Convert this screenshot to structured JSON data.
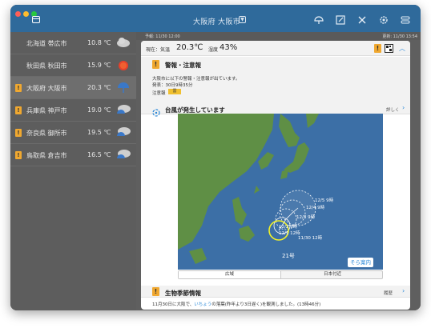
{
  "window": {
    "title": "大阪府 大阪市",
    "dropdown_glyph": "▼",
    "toolbar_icons": [
      "weather-icon",
      "edit-icon",
      "tools-icon",
      "settings-icon",
      "toggle-icon"
    ]
  },
  "sidebar": {
    "items": [
      {
        "warning": false,
        "city": "北海道 帯広市",
        "temp": "10.8 ℃",
        "icon": "cloudy-icon"
      },
      {
        "warning": false,
        "city": "秋田県 秋田市",
        "temp": "15.9 ℃",
        "icon": "sunny-icon"
      },
      {
        "warning": true,
        "city": "大阪府 大阪市",
        "temp": "20.3 ℃",
        "icon": "umbrella-icon"
      },
      {
        "warning": true,
        "city": "兵庫県 神戸市",
        "temp": "19.0 ℃",
        "icon": "rain-cloud-icon"
      },
      {
        "warning": true,
        "city": "奈良県 御所市",
        "temp": "19.5 ℃",
        "icon": "rain-cloud-icon"
      },
      {
        "warning": true,
        "city": "鳥取県 倉吉市",
        "temp": "16.5 ℃",
        "icon": "rain-cloud-icon"
      }
    ]
  },
  "status": {
    "left": "予報: 11/30 12:00",
    "right": "更新: 11/30 13:54"
  },
  "current": {
    "now_label": "現在：気温",
    "temp": "20.3℃",
    "humidity_label": "湿度",
    "humidity": "43%",
    "warning_glyph": "!"
  },
  "warnings": {
    "title": "警報・注意報",
    "line1": "大阪市に以下の警報・注意報が出ています。",
    "issued": "発表：30日9時35分",
    "advisory_label": "注意報",
    "advisory_value": "雷"
  },
  "typhoon": {
    "title": "台風が発生しています",
    "more": "詳しく",
    "name": "21号",
    "forecasts": [
      "12/5 9時",
      "12/4 9時",
      "12/3 9時",
      "12/2 9時",
      "12/1 12時",
      "11/30 12時"
    ],
    "logo": "そら案内",
    "tabs": [
      "広域",
      "日本付近"
    ]
  },
  "season": {
    "title": "生物季節情報",
    "more": "履歴",
    "text_pre": "11月30日に大阪で、",
    "text_link": "いちょう",
    "text_post": "の落葉(昨年より3日遅く)を観測しました。(13時46分)"
  },
  "colors": {
    "titlebar": "#2f6a9b",
    "accent": "#2a88d8",
    "warning": "#f0a830",
    "typhoon_track": "#f2f227"
  }
}
